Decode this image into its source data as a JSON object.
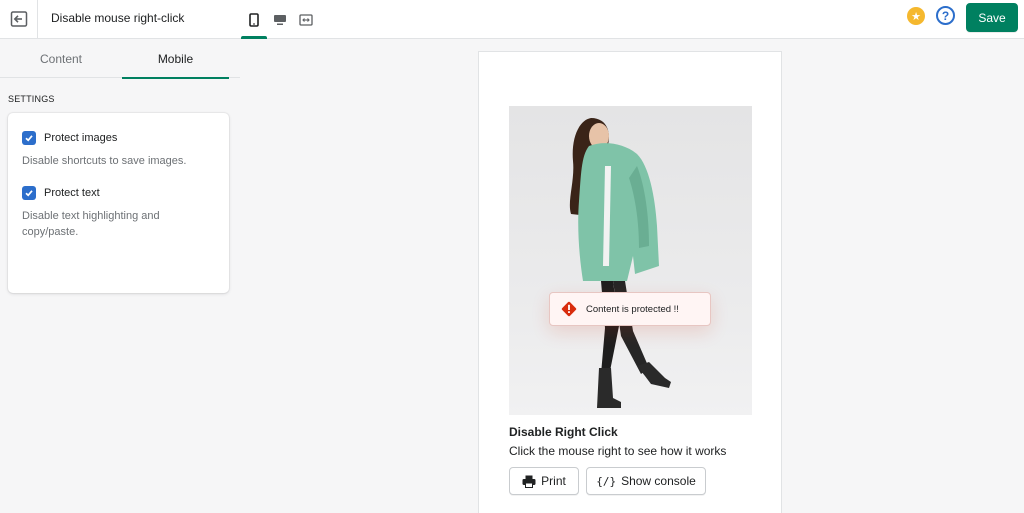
{
  "header": {
    "title": "Disable mouse right-click",
    "save_label": "Save",
    "view_icons": [
      "mobile-icon",
      "desktop-icon",
      "fullscreen-icon"
    ]
  },
  "tabs": [
    {
      "label": "Content",
      "active": false
    },
    {
      "label": "Mobile",
      "active": true
    }
  ],
  "settings": {
    "heading": "SETTINGS",
    "options": [
      {
        "label": "Protect images",
        "help": "Disable shortcuts to save images.",
        "checked": true
      },
      {
        "label": "Protect text",
        "help": "Disable text highlighting and copy/paste.",
        "checked": true
      }
    ]
  },
  "preview": {
    "toast": "Content is protected !!",
    "product_title": "Disable Right Click",
    "product_desc": "Click the mouse right to see how it works",
    "print_label": "Print",
    "console_glyph": "{/}",
    "console_label": "Show console"
  },
  "colors": {
    "accent": "#008060",
    "checkbox": "#2c6ecb",
    "warning": "#d82c0d",
    "star": "#f5b82e",
    "jacket": "#7fc3a8"
  }
}
